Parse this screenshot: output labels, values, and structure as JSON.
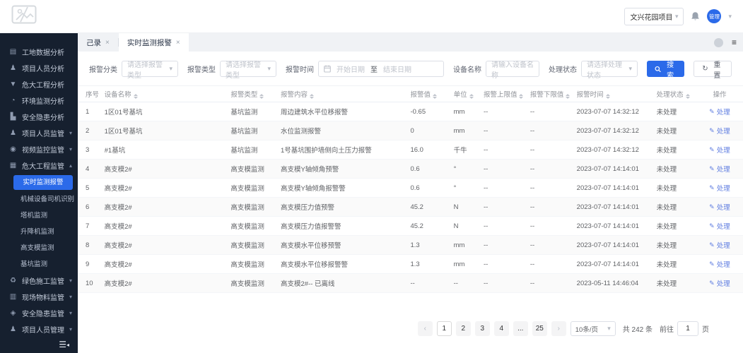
{
  "topbar": {
    "project": "文兴花园项目",
    "avatar": "管理"
  },
  "tabs": [
    {
      "label": "己录"
    },
    {
      "label": "实时监测报警"
    }
  ],
  "icons": {
    "chart-icon": "▤",
    "person-icon": "♟",
    "funnel-icon": "▼",
    "gauge-icon": "◔",
    "bars-icon": "▙",
    "people-icon": "♟",
    "camera-icon": "◉",
    "building-icon": "▦",
    "leaf-icon": "♻",
    "material-icon": "▥",
    "shield-icon": "◈",
    "user-icon": "♟"
  },
  "sidebar": {
    "menu": [
      {
        "type": "item",
        "icon": "chart-icon",
        "label": "工地数据分析"
      },
      {
        "type": "item",
        "icon": "person-icon",
        "label": "项目人员分析"
      },
      {
        "type": "item",
        "icon": "funnel-icon",
        "label": "危大工程分析"
      },
      {
        "type": "item",
        "icon": "gauge-icon",
        "label": "环境监测分析"
      },
      {
        "type": "item",
        "icon": "bars-icon",
        "label": "安全隐患分析"
      },
      {
        "type": "group",
        "icon": "people-icon",
        "label": "项目人员监管",
        "state": "collapsed"
      },
      {
        "type": "group",
        "icon": "camera-icon",
        "label": "视频监控监管",
        "state": "collapsed"
      },
      {
        "type": "group",
        "icon": "building-icon",
        "label": "危大工程监管",
        "state": "expanded"
      },
      {
        "type": "sub-active",
        "label": "实时监测报警"
      },
      {
        "type": "sub",
        "label": "机械设备司机识别"
      },
      {
        "type": "sub",
        "label": "塔机监测"
      },
      {
        "type": "sub",
        "label": "升降机监测"
      },
      {
        "type": "sub",
        "label": "高支模监测"
      },
      {
        "type": "sub",
        "label": "基坑监测"
      },
      {
        "type": "group",
        "icon": "leaf-icon",
        "label": "绿色施工监管",
        "state": "collapsed"
      },
      {
        "type": "group",
        "icon": "material-icon",
        "label": "现场物料监管",
        "state": "collapsed"
      },
      {
        "type": "group",
        "icon": "shield-icon",
        "label": "安全隐患监管",
        "state": "collapsed"
      },
      {
        "type": "group",
        "icon": "user-icon",
        "label": "项目人员管理",
        "state": "collapsed"
      }
    ]
  },
  "filters": {
    "category_label": "报警分类",
    "category_placeholder": "请选择报警类型",
    "type_label": "报警类型",
    "type_placeholder": "请选择报警类型",
    "time_label": "报警时间",
    "start_placeholder": "开始日期",
    "to": "至",
    "end_placeholder": "结束日期",
    "device_label": "设备名称",
    "device_placeholder": "请输入设备名称",
    "status_label": "处理状态",
    "status_placeholder": "请选择处理状态",
    "search_label": "搜索",
    "reset_label": "重置",
    "reset_icon": "↻"
  },
  "table": {
    "headers": [
      {
        "label": "序号",
        "sortable": false
      },
      {
        "label": "设备名称",
        "sortable": true
      },
      {
        "label": "报警类型",
        "sortable": true
      },
      {
        "label": "报警内容",
        "sortable": true
      },
      {
        "label": "报警值",
        "sortable": true
      },
      {
        "label": "单位",
        "sortable": true
      },
      {
        "label": "报警上限值",
        "sortable": true
      },
      {
        "label": "报警下限值",
        "sortable": true
      },
      {
        "label": "报警时间",
        "sortable": true
      },
      {
        "label": "处理状态",
        "sortable": true
      },
      {
        "label": "操作",
        "sortable": false
      }
    ],
    "action_label": "处理",
    "edit_icon": "✎",
    "rows": [
      [
        "1",
        "1区01号基坑",
        "基坑监测",
        "周边建筑水平位移报警",
        "-0.65",
        "mm",
        "--",
        "--",
        "2023-07-07 14:32:12",
        "未处理"
      ],
      [
        "2",
        "1区01号基坑",
        "基坑监测",
        "水位监测报警",
        "0",
        "mm",
        "--",
        "--",
        "2023-07-07 14:32:12",
        "未处理"
      ],
      [
        "3",
        "#1基坑",
        "基坑监测",
        "1号基坑围护墙侧向土压力报警",
        "16.0",
        "千牛",
        "--",
        "--",
        "2023-07-07 14:32:12",
        "未处理"
      ],
      [
        "4",
        "高支模2#",
        "高支模监测",
        "高支模Y轴倾角预警",
        "0.6",
        "°",
        "--",
        "--",
        "2023-07-07 14:14:01",
        "未处理"
      ],
      [
        "5",
        "高支模2#",
        "高支模监测",
        "高支模Y轴倾角报警警",
        "0.6",
        "°",
        "--",
        "--",
        "2023-07-07 14:14:01",
        "未处理"
      ],
      [
        "6",
        "高支模2#",
        "高支模监测",
        "高支模压力值预警",
        "45.2",
        "N",
        "--",
        "--",
        "2023-07-07 14:14:01",
        "未处理"
      ],
      [
        "7",
        "高支模2#",
        "高支模监测",
        "高支模压力值报警警",
        "45.2",
        "N",
        "--",
        "--",
        "2023-07-07 14:14:01",
        "未处理"
      ],
      [
        "8",
        "高支模2#",
        "高支模监测",
        "高支模水平位移预警",
        "1.3",
        "mm",
        "--",
        "--",
        "2023-07-07 14:14:01",
        "未处理"
      ],
      [
        "9",
        "高支模2#",
        "高支模监测",
        "高支模水平位移报警警",
        "1.3",
        "mm",
        "--",
        "--",
        "2023-07-07 14:14:01",
        "未处理"
      ],
      [
        "10",
        "高支模2#",
        "高支模监测",
        "高支模2#-- 已离线",
        "--",
        "--",
        "--",
        "--",
        "2023-05-11 14:46:04",
        "未处理"
      ]
    ]
  },
  "pagination": {
    "prev": "‹",
    "next": "›",
    "pages": [
      "1",
      "2",
      "3",
      "4",
      "...",
      "25"
    ],
    "active": "1",
    "page_size": "10条/页",
    "total": "共 242 条",
    "goto_label": "前往",
    "goto_value": "1",
    "page_label": "页"
  },
  "colors": {
    "accent": "#2b6ae9",
    "sidebar_bg": "#16202f",
    "link": "#5e7ce0"
  }
}
